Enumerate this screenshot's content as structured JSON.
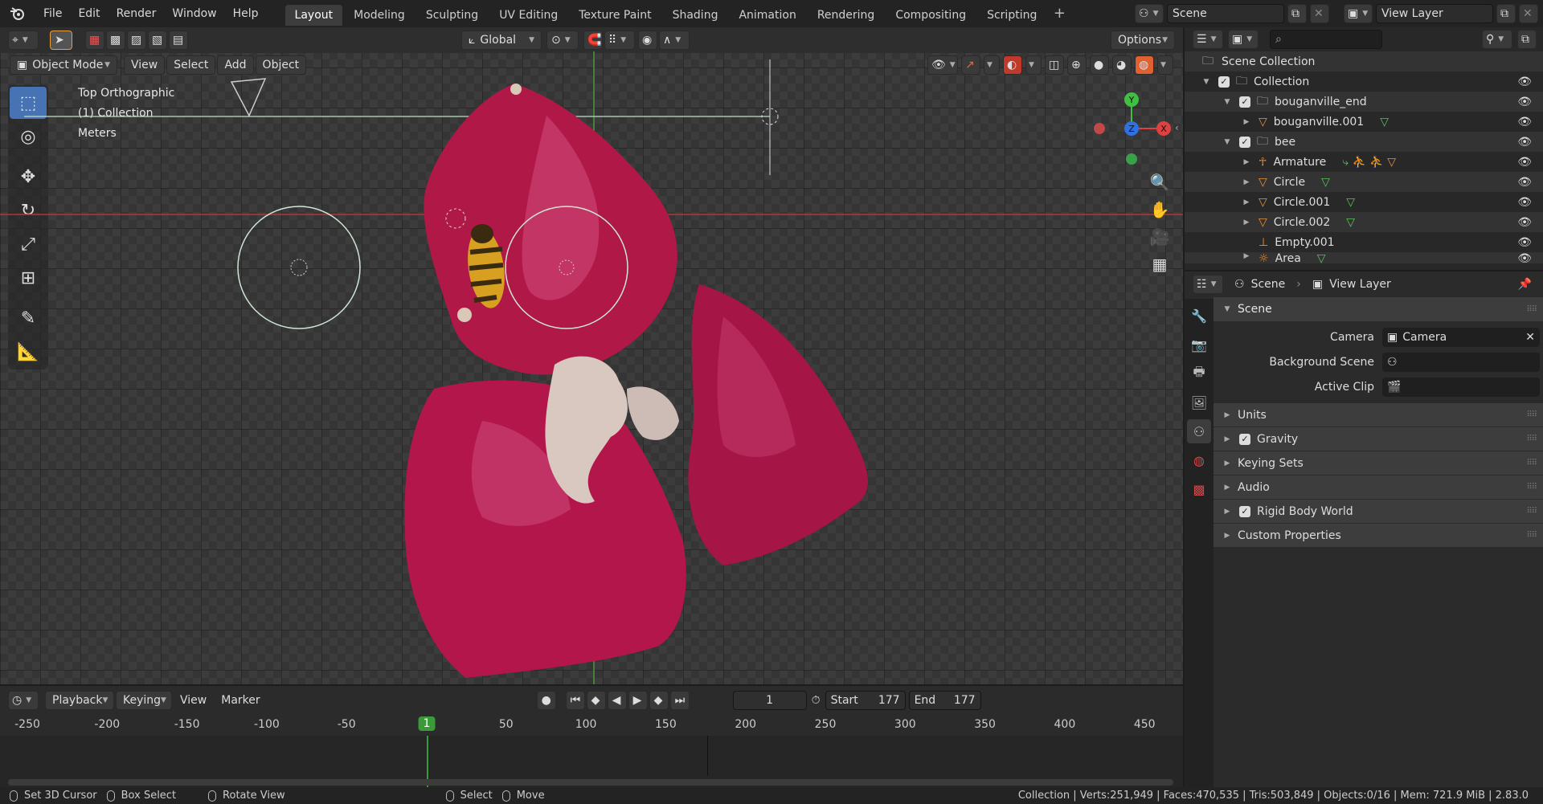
{
  "menu": {
    "items": [
      "File",
      "Edit",
      "Render",
      "Window",
      "Help"
    ]
  },
  "workspaces": {
    "tabs": [
      "Layout",
      "Modeling",
      "Sculpting",
      "UV Editing",
      "Texture Paint",
      "Shading",
      "Animation",
      "Rendering",
      "Compositing",
      "Scripting"
    ],
    "active": "Layout",
    "plus": "+"
  },
  "scene": {
    "name": "Scene",
    "view_layer": "View Layer"
  },
  "toolbar": {
    "transform_orientation": "Global",
    "options": "Options"
  },
  "viewport": {
    "mode": "Object Mode",
    "menus": [
      "View",
      "Select",
      "Add",
      "Object"
    ],
    "overlay_text": {
      "view": "Top Orthographic",
      "collection": "(1) Collection",
      "units": "Meters"
    },
    "gizmo": {
      "y": "Y",
      "z": "Z",
      "x": "X"
    }
  },
  "outliner": {
    "search_placeholder": "",
    "rows": [
      {
        "label": "Scene Collection",
        "indent": 0
      },
      {
        "label": "Collection",
        "indent": 1
      },
      {
        "label": "bouganville_end",
        "indent": 2
      },
      {
        "label": "bouganville.001",
        "indent": 3
      },
      {
        "label": "bee",
        "indent": 2
      },
      {
        "label": "Armature",
        "indent": 3
      },
      {
        "label": "Circle",
        "indent": 3
      },
      {
        "label": "Circle.001",
        "indent": 3
      },
      {
        "label": "Circle.002",
        "indent": 3
      },
      {
        "label": "Empty.001",
        "indent": 3
      },
      {
        "label": "Area",
        "indent": 2
      }
    ]
  },
  "properties": {
    "breadcrumb": {
      "scene": "Scene",
      "view_layer": "View Layer"
    },
    "panel_title": "Scene",
    "camera_label": "Camera",
    "camera_value": "Camera",
    "background_scene_label": "Background Scene",
    "active_clip_label": "Active Clip",
    "subpanels": {
      "units": "Units",
      "gravity": "Gravity",
      "keying_sets": "Keying Sets",
      "audio": "Audio",
      "rigid_body_world": "Rigid Body World",
      "custom_properties": "Custom Properties"
    },
    "gravity_checked": true,
    "rigid_body_checked": true
  },
  "timeline": {
    "menus": {
      "playback": "Playback",
      "keying": "Keying",
      "view": "View",
      "marker": "Marker"
    },
    "current_frame": "1",
    "start_label": "Start",
    "start_value": "177",
    "end_label": "End",
    "end_value": "177",
    "ruler": [
      "-250",
      "-200",
      "-150",
      "-100",
      "-50",
      "1",
      "50",
      "100",
      "150",
      "200",
      "250",
      "300",
      "350",
      "400",
      "450"
    ]
  },
  "statusbar": {
    "set_cursor": "Set 3D Cursor",
    "box_select": "Box Select",
    "rotate_view": "Rotate View",
    "select": "Select",
    "move": "Move",
    "stats": "Collection | Verts:251,949 | Faces:470,535 | Tris:503,849 | Objects:0/16 | Mem: 721.9 MiB | 2.83.0"
  },
  "colors": {
    "accent": "#4772b3",
    "frame_marker": "#3a9a3a",
    "petal": "#b01848",
    "x_axis": "#e04040",
    "y_axis": "#40c040",
    "z_axis": "#3070e0"
  }
}
